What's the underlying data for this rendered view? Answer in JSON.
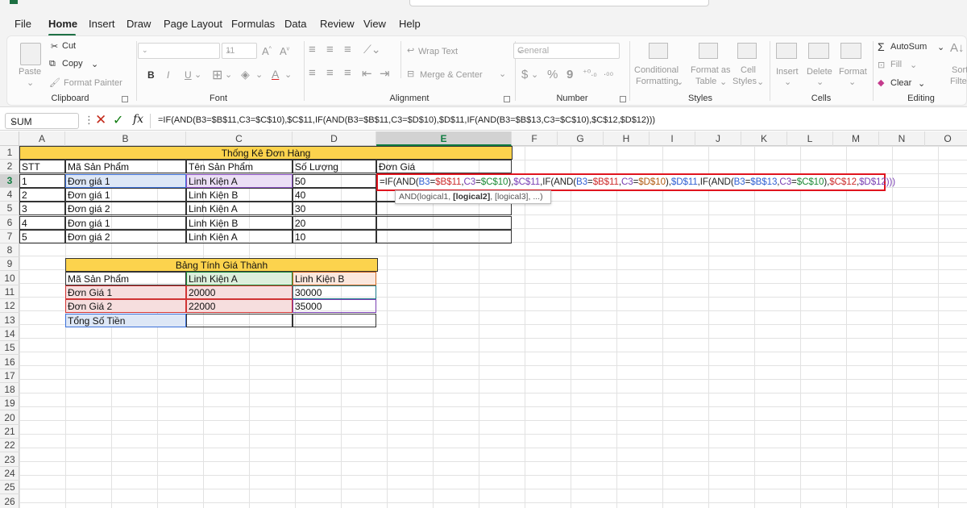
{
  "menu": [
    "File",
    "Home",
    "Insert",
    "Draw",
    "Page Layout",
    "Formulas",
    "Data",
    "Review",
    "View",
    "Help"
  ],
  "ribbon": {
    "clipboard": {
      "paste": "Paste",
      "cut": "Cut",
      "copy": "Copy",
      "format_painter": "Format Painter",
      "name": "Clipboard"
    },
    "font": {
      "size": "11",
      "bold": "B",
      "italic": "I",
      "underline": "U",
      "grow": "A^",
      "shrink": "A",
      "name": "Font"
    },
    "alignment": {
      "wrap": "Wrap Text",
      "merge": "Merge & Center",
      "name": "Alignment"
    },
    "number": {
      "format": "General",
      "currency": "$",
      "percent": "%",
      "comma": "9",
      "name": "Number"
    },
    "styles": {
      "conditional": "Conditional",
      "conditional2": "Formatting",
      "format_as": "Format as",
      "format_as2": "Table",
      "cell": "Cell",
      "cell2": "Styles",
      "name": "Styles"
    },
    "cells": {
      "insert": "Insert",
      "delete": "Delete",
      "format": "Format",
      "name": "Cells"
    },
    "editing": {
      "autosum": "AutoSum",
      "fill": "Fill",
      "clear": "Clear",
      "sort": "Sort &",
      "filter": "Filter",
      "name": "Editing"
    }
  },
  "formula_bar": {
    "name_box": "SUM",
    "formula": "=IF(AND(B3=$B$11,C3=$C$10),$C$11,IF(AND(B3=$B$11,C3=$D$10),$D$11,IF(AND(B3=$B$13,C3=$C$10),$C$12,$D$12)))"
  },
  "columns": [
    "A",
    "B",
    "C",
    "D",
    "E",
    "F",
    "G",
    "H",
    "I",
    "J",
    "K",
    "L",
    "M",
    "N",
    "O"
  ],
  "rows": [
    "1",
    "2",
    "3",
    "4",
    "5",
    "6",
    "7",
    "8",
    "9",
    "10",
    "11",
    "12",
    "13",
    "14",
    "15",
    "16",
    "17",
    "18",
    "19",
    "20",
    "21",
    "22",
    "23",
    "24",
    "25",
    "26"
  ],
  "table1": {
    "title": "Thống Kê Đơn Hàng",
    "headers": [
      "STT",
      "Mã Sản Phẩm",
      "Tên Sản Phẩm",
      "Số Lượng",
      "Đơn Giá"
    ],
    "rows": [
      [
        "1",
        "Đơn giá 1",
        "Linh Kiện A",
        "50"
      ],
      [
        "2",
        "Đơn giá 1",
        "Linh Kiện B",
        "40"
      ],
      [
        "3",
        "Đơn giá 2",
        "Linh Kiện A",
        "30"
      ],
      [
        "4",
        "Đơn giá 1",
        "Linh Kiện B",
        "20"
      ],
      [
        "5",
        "Đơn giá 2",
        "Linh Kiện A",
        "10"
      ]
    ]
  },
  "table2": {
    "title": "Bảng Tính Giá Thành",
    "headers": [
      "Mã Sản Phẩm",
      "Linh Kiện A",
      "Linh Kiện B"
    ],
    "rows": [
      [
        "Đơn Giá 1",
        "20000",
        "30000"
      ],
      [
        "Đơn Giá 2",
        "22000",
        "35000"
      ]
    ],
    "total_label": "Tổng Số Tiền"
  },
  "edit": {
    "p1": "=IF(AND(",
    "r1": "B3",
    "eq1": "=",
    "r2": "$B$11",
    "cm1": ",",
    "r3": "C3",
    "eq2": "=",
    "r4": "$C$10",
    "cl1": "),",
    "r5": "$C$11",
    "p2": ",IF(AND(",
    "r6": "B3",
    "eq3": "=",
    "r7": "$B$11",
    "cm2": ",",
    "r8": "C3",
    "eq4": "=",
    "r9": "$D$10",
    "cl2": "),",
    "r10": "$D$11",
    "p3": ",IF(AND(",
    "r11": "B3",
    "eq5": "=",
    "r12": "$B$13",
    "cm3": ",",
    "r13": "C3",
    "eq6": "=",
    "r14": "$C$10",
    "cl3": "),",
    "r15": "$C$12",
    "cm4": ",",
    "r16": "$D$12",
    "end": ")))"
  },
  "tooltip": {
    "pre": "AND(logical1, ",
    "bold": "[logical2]",
    "post": ", [logical3], ...)"
  },
  "colors": {
    "accent": "#107c41",
    "title_fill": "#fcd34d",
    "edit_border": "#e0141e"
  }
}
